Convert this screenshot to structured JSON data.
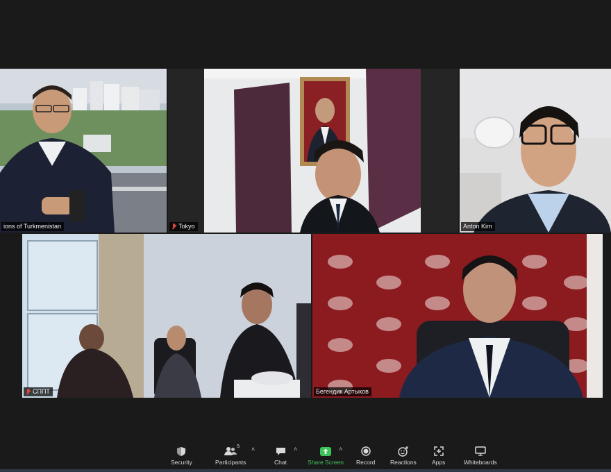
{
  "participants": [
    {
      "name": "ions of Turkmenistan",
      "muted": false,
      "active": true
    },
    {
      "name": "Tokyo",
      "muted": true,
      "active": false
    },
    {
      "name": "Anton Kim",
      "muted": false,
      "active": false
    },
    {
      "name": "СППТ",
      "muted": true,
      "active": false
    },
    {
      "name": "Бегендик Артыков",
      "muted": false,
      "active": false
    }
  ],
  "toolbar": {
    "security": "Security",
    "participants": "Participants",
    "participants_count": "5",
    "chat": "Chat",
    "share_screen": "Share Screen",
    "record": "Record",
    "reactions": "Reactions",
    "apps": "Apps",
    "whiteboards": "Whiteboards"
  },
  "colors": {
    "active_outline": "#c7e03a",
    "share_green": "#3ec35a",
    "muted_red": "#e5443a"
  },
  "icons": [
    "shield-icon",
    "participants-icon",
    "chat-icon",
    "share-screen-icon",
    "record-icon",
    "reactions-icon",
    "apps-icon",
    "whiteboard-icon",
    "mic-muted-icon"
  ]
}
